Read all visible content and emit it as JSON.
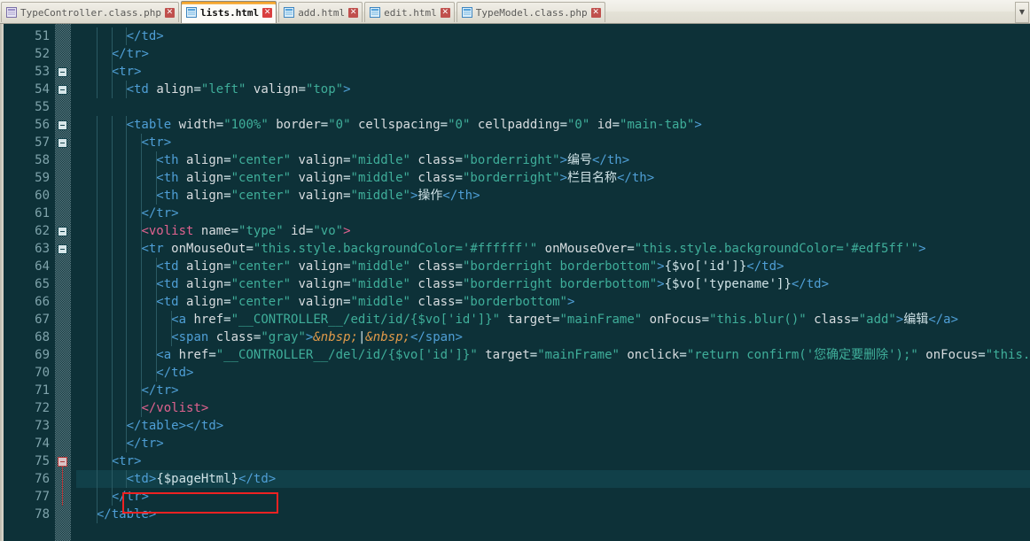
{
  "tabs": [
    {
      "label": "TypeController.class.php",
      "icon": "php-file-icon",
      "active": false,
      "close": "✕"
    },
    {
      "label": "lists.html",
      "icon": "html-file-icon",
      "active": true,
      "close": "✕"
    },
    {
      "label": "add.html",
      "icon": "html-file-icon",
      "active": false,
      "close": "✕"
    },
    {
      "label": "edit.html",
      "icon": "html-file-icon",
      "active": false,
      "close": "✕"
    },
    {
      "label": "TypeModel.class.php",
      "icon": "php-file-icon",
      "active": false,
      "close": "✕"
    }
  ],
  "tab_overflow_label": "▼",
  "colors": {
    "editor_background": "#0d3138",
    "current_line_background": "#114049",
    "line_number": "#7fa3ab",
    "tag": "#4f9fd6",
    "attribute": "#d8dde0",
    "value": "#3fae9a",
    "custom_tag": "#e0628f",
    "entity": "#e09a4a",
    "highlight_rect": "#ee2222",
    "active_tab_underline": "#f4a42b"
  },
  "editor": {
    "first_line": 51,
    "last_line": 78,
    "current_line": 76,
    "highlighted_text": "<td>{$pageHtml}</td>",
    "line_numbers": [
      51,
      52,
      53,
      54,
      55,
      56,
      57,
      58,
      59,
      60,
      61,
      62,
      63,
      64,
      65,
      66,
      67,
      68,
      69,
      70,
      71,
      72,
      73,
      74,
      75,
      76,
      77,
      78
    ],
    "fold_markers": [
      53,
      54,
      56,
      57,
      62,
      63,
      75
    ],
    "fold_marker_highlighted": 75,
    "lines": [
      {
        "n": 51,
        "text": "      </td>"
      },
      {
        "n": 52,
        "text": "    </tr>"
      },
      {
        "n": 53,
        "text": "    <tr>"
      },
      {
        "n": 54,
        "text": "      <td align=\"left\" valign=\"top\">"
      },
      {
        "n": 55,
        "text": ""
      },
      {
        "n": 56,
        "text": "      <table width=\"100%\" border=\"0\" cellspacing=\"0\" cellpadding=\"0\" id=\"main-tab\">"
      },
      {
        "n": 57,
        "text": "        <tr>"
      },
      {
        "n": 58,
        "text": "          <th align=\"center\" valign=\"middle\" class=\"borderright\">编号</th>"
      },
      {
        "n": 59,
        "text": "          <th align=\"center\" valign=\"middle\" class=\"borderright\">栏目名称</th>"
      },
      {
        "n": 60,
        "text": "          <th align=\"center\" valign=\"middle\">操作</th>"
      },
      {
        "n": 61,
        "text": "        </tr>"
      },
      {
        "n": 62,
        "text": "        <volist name=\"type\" id=\"vo\">"
      },
      {
        "n": 63,
        "text": "        <tr onMouseOut=\"this.style.backgroundColor='#ffffff'\" onMouseOver=\"this.style.backgroundColor='#edf5ff'\">"
      },
      {
        "n": 64,
        "text": "          <td align=\"center\" valign=\"middle\" class=\"borderright borderbottom\">{$vo['id']}</td>"
      },
      {
        "n": 65,
        "text": "          <td align=\"center\" valign=\"middle\" class=\"borderright borderbottom\">{$vo['typename']}</td>"
      },
      {
        "n": 66,
        "text": "          <td align=\"center\" valign=\"middle\" class=\"borderbottom\">"
      },
      {
        "n": 67,
        "text": "            <a href=\"__CONTROLLER__/edit/id/{$vo['id']}\" target=\"mainFrame\" onFocus=\"this.blur()\" class=\"add\">编辑</a>"
      },
      {
        "n": 68,
        "text": "            <span class=\"gray\">&nbsp;|&nbsp;</span>"
      },
      {
        "n": 69,
        "text": "          <a href=\"__CONTROLLER__/del/id/{$vo['id']}\" target=\"mainFrame\" onclick=\"return confirm('您确定要删除');\" onFocus=\"this.blur()\" class=\"add\">删除</a>"
      },
      {
        "n": 70,
        "text": "          </td>"
      },
      {
        "n": 71,
        "text": "        </tr>"
      },
      {
        "n": 72,
        "text": "        </volist>"
      },
      {
        "n": 73,
        "text": "      </table></td>"
      },
      {
        "n": 74,
        "text": "      </tr>"
      },
      {
        "n": 75,
        "text": "    <tr>"
      },
      {
        "n": 76,
        "text": "      <td>{$pageHtml}</td>"
      },
      {
        "n": 77,
        "text": "    </tr>"
      },
      {
        "n": 78,
        "text": "  </table>"
      }
    ]
  }
}
